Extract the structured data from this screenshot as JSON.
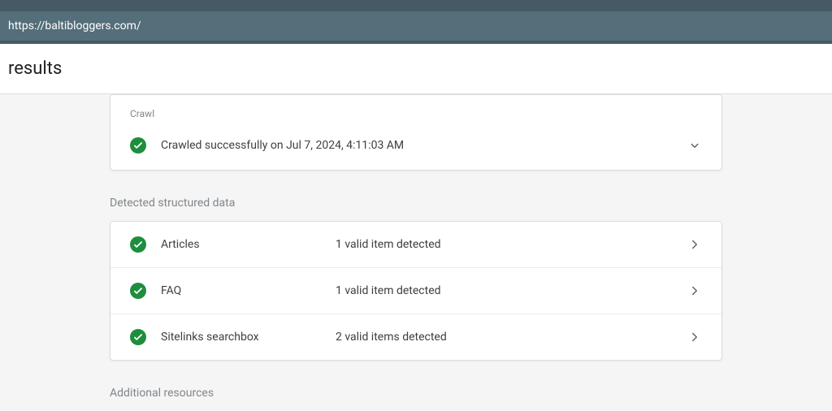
{
  "url_bar": {
    "url": "https://baltibloggers.com/"
  },
  "header": {
    "title": "results"
  },
  "crawl": {
    "section_label": "Crawl",
    "status_text": "Crawled successfully on Jul 7, 2024, 4:11:03 AM"
  },
  "structured_data": {
    "section_label": "Detected structured data",
    "items": [
      {
        "name": "Articles",
        "status": "1 valid item detected"
      },
      {
        "name": "FAQ",
        "status": "1 valid item detected"
      },
      {
        "name": "Sitelinks searchbox",
        "status": "2 valid items detected"
      }
    ]
  },
  "additional": {
    "section_label": "Additional resources"
  }
}
